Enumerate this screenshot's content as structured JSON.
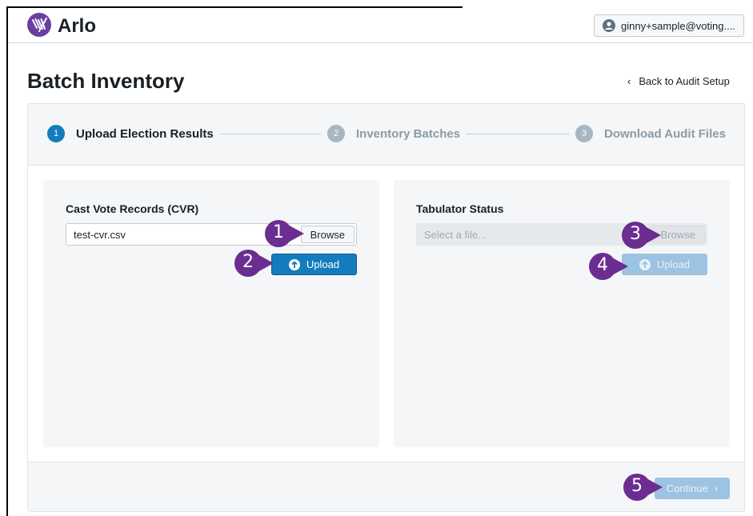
{
  "app": {
    "brand": "Arlo",
    "user": "ginny+sample@voting...."
  },
  "page": {
    "title": "Batch Inventory",
    "back_link": "Back to Audit Setup"
  },
  "steps": [
    {
      "number": "1",
      "label": "Upload Election Results",
      "state": "active"
    },
    {
      "number": "2",
      "label": "Inventory Batches",
      "state": "inactive"
    },
    {
      "number": "3",
      "label": "Download Audit Files",
      "state": "inactive"
    }
  ],
  "cvr_panel": {
    "title": "Cast Vote Records (CVR)",
    "file_value": "test-cvr.csv",
    "browse_label": "Browse",
    "upload_label": "Upload"
  },
  "tabulator_panel": {
    "title": "Tabulator Status",
    "file_placeholder": "Select a file...",
    "browse_label": "Browse",
    "upload_label": "Upload"
  },
  "footer": {
    "continue_label": "Continue"
  },
  "callouts": [
    "1",
    "2",
    "3",
    "4",
    "5"
  ],
  "colors": {
    "primary": "#137cbd",
    "primary_disabled": "#9cc3e2",
    "callout": "#6b2d8f",
    "logo": "#6b3fa0"
  }
}
